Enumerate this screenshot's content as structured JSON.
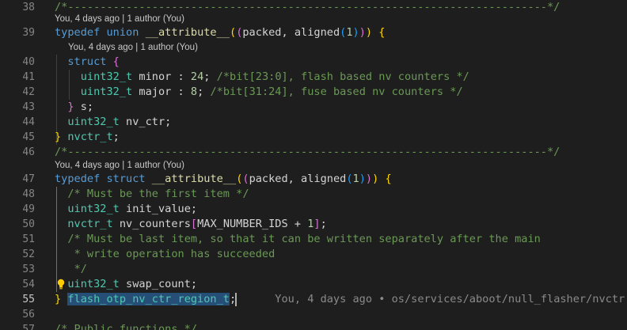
{
  "editor": {
    "lines": [
      {
        "num": "38",
        "segments": [
          {
            "t": "/*--------------------------------------------------------------------------*/",
            "c": "cm"
          }
        ]
      },
      {
        "num": "39",
        "segments": [
          {
            "t": "typedef",
            "c": "kw"
          },
          {
            "t": " ",
            "c": "pn"
          },
          {
            "t": "union",
            "c": "kw"
          },
          {
            "t": " ",
            "c": "pn"
          },
          {
            "t": "__attribute__",
            "c": "fn"
          },
          {
            "t": "(",
            "c": "b1"
          },
          {
            "t": "(",
            "c": "b2"
          },
          {
            "t": "packed, aligned",
            "c": "pn"
          },
          {
            "t": "(",
            "c": "b3"
          },
          {
            "t": "1",
            "c": "nu"
          },
          {
            "t": ")",
            "c": "b3"
          },
          {
            "t": ")",
            "c": "b2"
          },
          {
            "t": ")",
            "c": "b1"
          },
          {
            "t": " ",
            "c": "pn"
          },
          {
            "t": "{",
            "c": "b1"
          }
        ]
      },
      {
        "num": "40",
        "segments": [
          {
            "t": "  ",
            "c": "pn"
          },
          {
            "t": "struct",
            "c": "kw"
          },
          {
            "t": " ",
            "c": "pn"
          },
          {
            "t": "{",
            "c": "b2"
          }
        ]
      },
      {
        "num": "41",
        "segments": [
          {
            "t": "    ",
            "c": "pn"
          },
          {
            "t": "uint32_t",
            "c": "ty"
          },
          {
            "t": " minor : ",
            "c": "pn"
          },
          {
            "t": "24",
            "c": "nu"
          },
          {
            "t": "; ",
            "c": "pn"
          },
          {
            "t": "/*bit[23:0], flash based nv counters */",
            "c": "cm"
          }
        ]
      },
      {
        "num": "42",
        "segments": [
          {
            "t": "    ",
            "c": "pn"
          },
          {
            "t": "uint32_t",
            "c": "ty"
          },
          {
            "t": " major : ",
            "c": "pn"
          },
          {
            "t": "8",
            "c": "nu"
          },
          {
            "t": "; ",
            "c": "pn"
          },
          {
            "t": "/*bit[31:24], fuse based nv counters */",
            "c": "cm"
          }
        ]
      },
      {
        "num": "43",
        "segments": [
          {
            "t": "  ",
            "c": "pn"
          },
          {
            "t": "}",
            "c": "b2"
          },
          {
            "t": " s;",
            "c": "pn"
          }
        ]
      },
      {
        "num": "44",
        "segments": [
          {
            "t": "  ",
            "c": "pn"
          },
          {
            "t": "uint32_t",
            "c": "ty"
          },
          {
            "t": " nv_ctr;",
            "c": "pn"
          }
        ]
      },
      {
        "num": "45",
        "segments": [
          {
            "t": "}",
            "c": "b1"
          },
          {
            "t": " ",
            "c": "pn"
          },
          {
            "t": "nvctr_t",
            "c": "ty"
          },
          {
            "t": ";",
            "c": "pn"
          }
        ]
      },
      {
        "num": "46",
        "segments": [
          {
            "t": "/*--------------------------------------------------------------------------*/",
            "c": "cm"
          }
        ]
      },
      {
        "num": "47",
        "segments": [
          {
            "t": "typedef",
            "c": "kw"
          },
          {
            "t": " ",
            "c": "pn"
          },
          {
            "t": "struct",
            "c": "kw"
          },
          {
            "t": " ",
            "c": "pn"
          },
          {
            "t": "__attribute__",
            "c": "fn"
          },
          {
            "t": "(",
            "c": "b1"
          },
          {
            "t": "(",
            "c": "b2"
          },
          {
            "t": "packed, aligned",
            "c": "pn"
          },
          {
            "t": "(",
            "c": "b3"
          },
          {
            "t": "1",
            "c": "nu"
          },
          {
            "t": ")",
            "c": "b3"
          },
          {
            "t": ")",
            "c": "b2"
          },
          {
            "t": ")",
            "c": "b1"
          },
          {
            "t": " ",
            "c": "pn"
          },
          {
            "t": "{",
            "c": "b1"
          }
        ]
      },
      {
        "num": "48",
        "segments": [
          {
            "t": "  ",
            "c": "pn"
          },
          {
            "t": "/* Must be the first item */",
            "c": "cm"
          }
        ]
      },
      {
        "num": "49",
        "segments": [
          {
            "t": "  ",
            "c": "pn"
          },
          {
            "t": "uint32_t",
            "c": "ty"
          },
          {
            "t": " init_value;",
            "c": "pn"
          }
        ]
      },
      {
        "num": "50",
        "segments": [
          {
            "t": "  ",
            "c": "pn"
          },
          {
            "t": "nvctr_t",
            "c": "ty"
          },
          {
            "t": " nv_counters",
            "c": "pn"
          },
          {
            "t": "[",
            "c": "b2"
          },
          {
            "t": "MAX_NUMBER_IDS + ",
            "c": "pn"
          },
          {
            "t": "1",
            "c": "nu"
          },
          {
            "t": "]",
            "c": "b2"
          },
          {
            "t": ";",
            "c": "pn"
          }
        ]
      },
      {
        "num": "51",
        "segments": [
          {
            "t": "  ",
            "c": "pn"
          },
          {
            "t": "/* Must be last item, so that it can be written separately after the main",
            "c": "cm"
          }
        ]
      },
      {
        "num": "52",
        "segments": [
          {
            "t": "   ",
            "c": "pn"
          },
          {
            "t": "* write operation has succeeded",
            "c": "cm"
          }
        ]
      },
      {
        "num": "53",
        "segments": [
          {
            "t": "   ",
            "c": "pn"
          },
          {
            "t": "*/",
            "c": "cm"
          }
        ]
      },
      {
        "num": "54",
        "segments": [
          {
            "t": "  ",
            "c": "pn"
          },
          {
            "t": "uint32_t",
            "c": "ty"
          },
          {
            "t": " swap_count;",
            "c": "pn"
          }
        ]
      },
      {
        "num": "55",
        "segments": [
          {
            "t": "}",
            "c": "b1"
          },
          {
            "t": " ",
            "c": "pn"
          },
          {
            "t": "flash_otp_nv_ctr_region_t",
            "c": "ty sel"
          },
          {
            "t": ";",
            "c": "pn"
          },
          {
            "t": "      You, 4 days ago • os/services/aboot/null_flasher/nvctr",
            "c": "blame"
          }
        ]
      },
      {
        "num": "56",
        "segments": []
      },
      {
        "num": "57",
        "segments": [
          {
            "t": "/* Public functions */",
            "c": "cm"
          }
        ]
      }
    ],
    "codelens": [
      "You, 4 days ago | 1 author (You)",
      "You, 4 days ago | 1 author (You)",
      "You, 4 days ago | 1 author (You)"
    ],
    "active_line": "55"
  }
}
